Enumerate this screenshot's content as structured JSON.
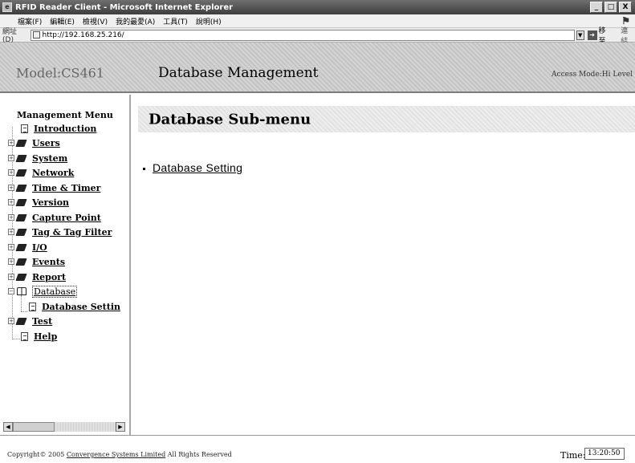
{
  "window": {
    "title": "RFID Reader Client - Microsoft Internet Explorer",
    "minimize": "_",
    "maximize": "□",
    "close": "X"
  },
  "menubar": {
    "items": [
      "檔案(F)",
      "編輯(E)",
      "檢視(V)",
      "我的最愛(A)",
      "工具(T)",
      "說明(H)"
    ]
  },
  "address": {
    "label": "網址(D)",
    "url": "http://192.168.25.216/",
    "go_label": "移至",
    "links_label": "連結"
  },
  "header": {
    "model": "Model:CS461",
    "title": "Database Management",
    "access_mode": "Access Mode:Hi Level"
  },
  "sidebar": {
    "heading": "Management Menu",
    "items": [
      {
        "label": "Introduction",
        "icon": "document-icon"
      },
      {
        "label": "Users",
        "icon": "book-icon"
      },
      {
        "label": "System",
        "icon": "book-icon"
      },
      {
        "label": "Network",
        "icon": "book-icon"
      },
      {
        "label": "Time & Timer",
        "icon": "book-icon"
      },
      {
        "label": "Version",
        "icon": "book-icon"
      },
      {
        "label": "Capture Point",
        "icon": "book-icon"
      },
      {
        "label": "Tag & Tag Filter",
        "icon": "book-icon"
      },
      {
        "label": "I/O",
        "icon": "book-icon"
      },
      {
        "label": "Events",
        "icon": "book-icon"
      },
      {
        "label": "Report",
        "icon": "book-icon"
      },
      {
        "label": "Database",
        "icon": "open-book-icon"
      },
      {
        "label": "Database Settin",
        "icon": "document-icon"
      },
      {
        "label": "Test",
        "icon": "book-icon"
      },
      {
        "label": "Help",
        "icon": "document-icon"
      }
    ]
  },
  "main": {
    "sub_title": "Database Sub-menu",
    "links": [
      "Database Setting"
    ]
  },
  "footer": {
    "copyright_prefix": "Copyright© 2005 ",
    "company": "Convergence Systems Limited",
    "copyright_suffix": " All Rights Reserved",
    "time_label": "Time:",
    "time_value": "13:20:50"
  }
}
